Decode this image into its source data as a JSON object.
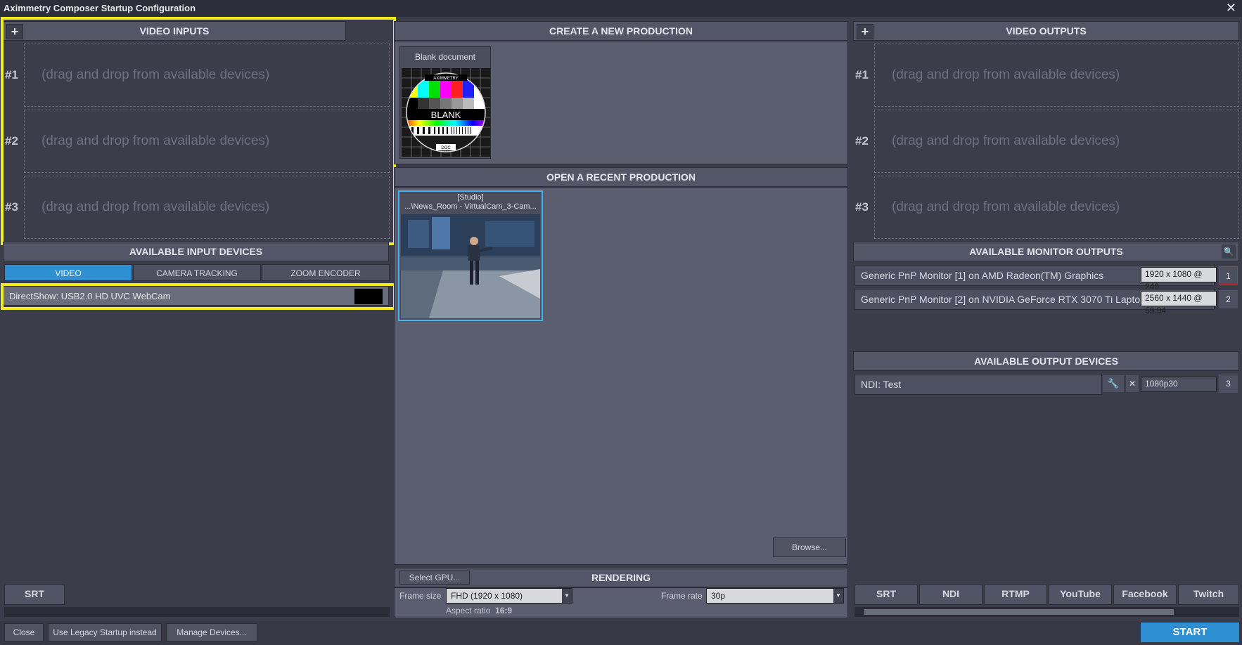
{
  "window": {
    "title": "Aximmetry Composer Startup Configuration",
    "close": "✕"
  },
  "video_inputs": {
    "title": "VIDEO INPUTS",
    "add": "+",
    "slots": [
      {
        "num": "#1",
        "text": "(drag and drop from available devices)"
      },
      {
        "num": "#2",
        "text": "(drag and drop from available devices)"
      },
      {
        "num": "#3",
        "text": "(drag and drop from available devices)"
      }
    ]
  },
  "available_inputs": {
    "title": "AVAILABLE INPUT DEVICES",
    "tabs": [
      "VIDEO",
      "CAMERA TRACKING",
      "ZOOM ENCODER"
    ],
    "device": "DirectShow: USB2.0 HD UVC WebCam",
    "srt": "SRT"
  },
  "create": {
    "title": "CREATE A NEW PRODUCTION",
    "blank_label": "Blank document",
    "blank_logo_top": "AXIMMETRY",
    "blank_logo": "BLANK",
    "blank_logo_bottom": "DOC"
  },
  "recent": {
    "title": "OPEN A RECENT PRODUCTION",
    "item_line1": "[Studio]",
    "item_line2": "...\\News_Room - VirtualCam_3-Cam...",
    "browse": "Browse..."
  },
  "rendering": {
    "title": "RENDERING",
    "select_gpu": "Select GPU...",
    "frame_size_label": "Frame size",
    "frame_size": "FHD (1920 x 1080)",
    "frame_rate_label": "Frame rate",
    "frame_rate": "30p",
    "aspect_label": "Aspect ratio",
    "aspect": "16:9"
  },
  "video_outputs": {
    "title": "VIDEO OUTPUTS",
    "add": "+",
    "slots": [
      {
        "num": "#1",
        "text": "(drag and drop from available devices)"
      },
      {
        "num": "#2",
        "text": "(drag and drop from available devices)"
      },
      {
        "num": "#3",
        "text": "(drag and drop from available devices)"
      }
    ]
  },
  "monitor_outputs": {
    "title": "AVAILABLE MONITOR OUTPUTS",
    "rows": [
      {
        "name": "Generic PnP Monitor [1] on AMD Radeon(TM) Graphics",
        "res": "1920 x 1080 @ 240",
        "index": "1"
      },
      {
        "name": "Generic PnP Monitor [2] on NVIDIA GeForce RTX 3070 Ti Laptop GPU",
        "res": "2560 x 1440 @ 59.94",
        "index": "2"
      }
    ]
  },
  "output_devices": {
    "title": "AVAILABLE OUTPUT DEVICES",
    "rows": [
      {
        "name": "NDI: Test",
        "res": "1080p30",
        "index": "3"
      }
    ],
    "tabs": [
      "SRT",
      "NDI",
      "RTMP",
      "YouTube",
      "Facebook",
      "Twitch"
    ]
  },
  "footer": {
    "close": "Close",
    "legacy": "Use Legacy Startup instead",
    "manage": "Manage Devices...",
    "start": "START"
  },
  "colors": {
    "accent": "#2f8fd3",
    "highlight": "#f2ee1c",
    "background": "#3b3e4a"
  }
}
